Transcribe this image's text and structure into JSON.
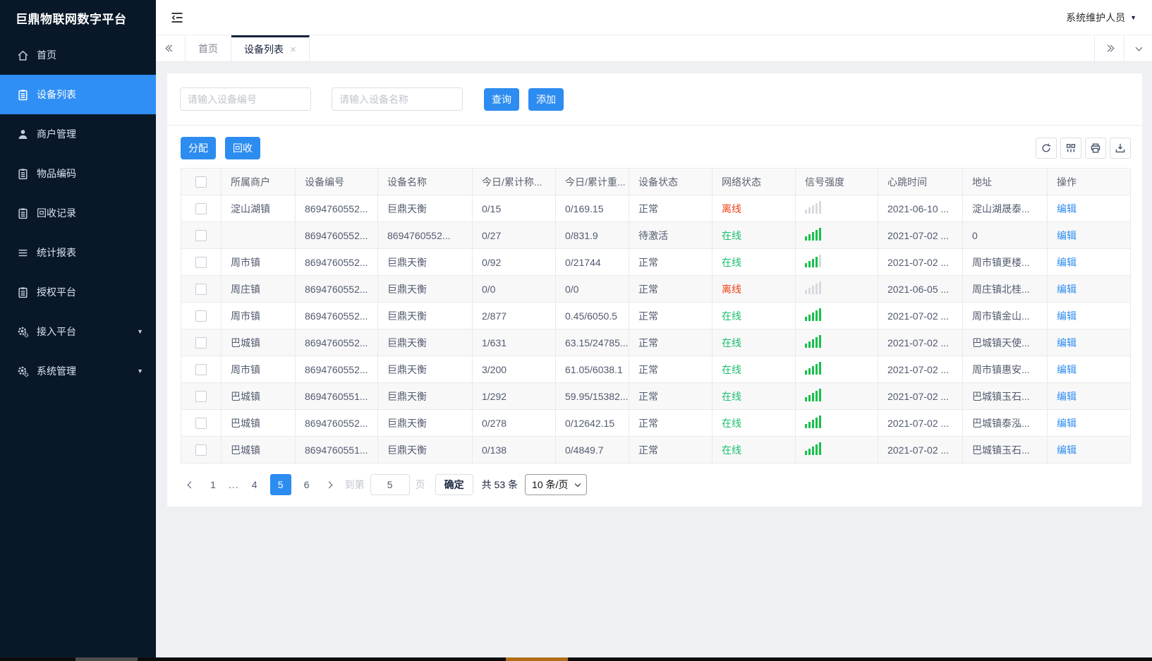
{
  "app": {
    "title": "巨鼎物联网数字平台",
    "user_name": "系统维护人员"
  },
  "sidebar": {
    "items": [
      {
        "key": "home",
        "label": "首页",
        "icon": "home-icon",
        "active": false,
        "caret": false
      },
      {
        "key": "device-list",
        "label": "设备列表",
        "icon": "device-list-icon",
        "active": true,
        "caret": false
      },
      {
        "key": "merchant-mgmt",
        "label": "商户管理",
        "icon": "merchant-icon",
        "active": false,
        "caret": false
      },
      {
        "key": "item-code",
        "label": "物品编码",
        "icon": "item-code-icon",
        "active": false,
        "caret": false
      },
      {
        "key": "recycle-records",
        "label": "回收记录",
        "icon": "recycle-record-icon",
        "active": false,
        "caret": false
      },
      {
        "key": "statistics-report",
        "label": "统计报表",
        "icon": "report-icon",
        "active": false,
        "caret": false
      },
      {
        "key": "authorize-platform",
        "label": "授权平台",
        "icon": "authorize-icon",
        "active": false,
        "caret": false
      },
      {
        "key": "access-platform",
        "label": "接入平台",
        "icon": "access-gear-icon",
        "active": false,
        "caret": true
      },
      {
        "key": "system-mgmt",
        "label": "系统管理",
        "icon": "system-gear-icon",
        "active": false,
        "caret": true
      }
    ]
  },
  "tabbar": {
    "tabs": [
      {
        "key": "home",
        "label": "首页",
        "active": false,
        "closable": false
      },
      {
        "key": "device-list",
        "label": "设备列表",
        "active": true,
        "closable": true
      }
    ]
  },
  "filters": {
    "code_placeholder": "请输入设备编号",
    "name_placeholder": "请输入设备名称",
    "query_label": "查询",
    "add_label": "添加"
  },
  "toolbar": {
    "assign_label": "分配",
    "recycle_label": "回收",
    "icons": [
      {
        "key": "refresh",
        "icon": "refresh-icon"
      },
      {
        "key": "columns",
        "icon": "columns-icon"
      },
      {
        "key": "print",
        "icon": "print-icon"
      },
      {
        "key": "export",
        "icon": "export-icon"
      }
    ]
  },
  "table": {
    "columns": [
      "所属商户",
      "设备编号",
      "设备名称",
      "今日/累计称...",
      "今日/累计重...",
      "设备状态",
      "网络状态",
      "信号强度",
      "心跳时间",
      "地址",
      "操作"
    ],
    "edit_label": "编辑",
    "rows": [
      {
        "merchant": "淀山湖镇",
        "device_code": "8694760552...",
        "device_name": "巨鼎天衡",
        "today_count": "0/15",
        "today_weight": "0/169.15",
        "device_status": "正常",
        "network_status": "离线",
        "online": false,
        "signal_green": 0,
        "heartbeat": "2021-06-10 ...",
        "address": "淀山湖晟泰..."
      },
      {
        "merchant": "",
        "device_code": "8694760552...",
        "device_name": "8694760552...",
        "today_count": "0/27",
        "today_weight": "0/831.9",
        "device_status": "待激活",
        "network_status": "在线",
        "online": true,
        "signal_green": 5,
        "heartbeat": "2021-07-02 ...",
        "address": "0"
      },
      {
        "merchant": "周市镇",
        "device_code": "8694760552...",
        "device_name": "巨鼎天衡",
        "today_count": "0/92",
        "today_weight": "0/21744",
        "device_status": "正常",
        "network_status": "在线",
        "online": true,
        "signal_green": 4,
        "heartbeat": "2021-07-02 ...",
        "address": "周市镇更楼..."
      },
      {
        "merchant": "周庄镇",
        "device_code": "8694760552...",
        "device_name": "巨鼎天衡",
        "today_count": "0/0",
        "today_weight": "0/0",
        "device_status": "正常",
        "network_status": "离线",
        "online": false,
        "signal_green": 0,
        "heartbeat": "2021-06-05 ...",
        "address": "周庄镇北桂..."
      },
      {
        "merchant": "周市镇",
        "device_code": "8694760552...",
        "device_name": "巨鼎天衡",
        "today_count": "2/877",
        "today_weight": "0.45/6050.5",
        "device_status": "正常",
        "network_status": "在线",
        "online": true,
        "signal_green": 5,
        "heartbeat": "2021-07-02 ...",
        "address": "周市镇金山..."
      },
      {
        "merchant": "巴城镇",
        "device_code": "8694760552...",
        "device_name": "巨鼎天衡",
        "today_count": "1/631",
        "today_weight": "63.15/24785...",
        "device_status": "正常",
        "network_status": "在线",
        "online": true,
        "signal_green": 5,
        "heartbeat": "2021-07-02 ...",
        "address": "巴城镇天使..."
      },
      {
        "merchant": "周市镇",
        "device_code": "8694760552...",
        "device_name": "巨鼎天衡",
        "today_count": "3/200",
        "today_weight": "61.05/6038.1",
        "device_status": "正常",
        "network_status": "在线",
        "online": true,
        "signal_green": 5,
        "heartbeat": "2021-07-02 ...",
        "address": "周市镇惠安..."
      },
      {
        "merchant": "巴城镇",
        "device_code": "8694760551...",
        "device_name": "巨鼎天衡",
        "today_count": "1/292",
        "today_weight": "59.95/15382...",
        "device_status": "正常",
        "network_status": "在线",
        "online": true,
        "signal_green": 5,
        "heartbeat": "2021-07-02 ...",
        "address": "巴城镇玉石..."
      },
      {
        "merchant": "巴城镇",
        "device_code": "8694760552...",
        "device_name": "巨鼎天衡",
        "today_count": "0/278",
        "today_weight": "0/12642.15",
        "device_status": "正常",
        "network_status": "在线",
        "online": true,
        "signal_green": 5,
        "heartbeat": "2021-07-02 ...",
        "address": "巴城镇泰泓..."
      },
      {
        "merchant": "巴城镇",
        "device_code": "8694760551...",
        "device_name": "巨鼎天衡",
        "today_count": "0/138",
        "today_weight": "0/4849.7",
        "device_status": "正常",
        "network_status": "在线",
        "online": true,
        "signal_green": 5,
        "heartbeat": "2021-07-02 ...",
        "address": "巴城镇玉石..."
      }
    ]
  },
  "pagination": {
    "pages": [
      "1",
      "...",
      "4",
      "5",
      "6"
    ],
    "active_page": "5",
    "goto_prefix": "到第",
    "goto_value": "5",
    "goto_suffix": "页",
    "confirm_label": "确定",
    "total_label": "共 53 条",
    "page_size_label": "10 条/页"
  },
  "colors": {
    "primary": "#2d8cf0",
    "success": "#19be6b",
    "danger": "#ed3f14",
    "sidebar_bg": "#081829",
    "active_menu": "#2f8ff5"
  }
}
